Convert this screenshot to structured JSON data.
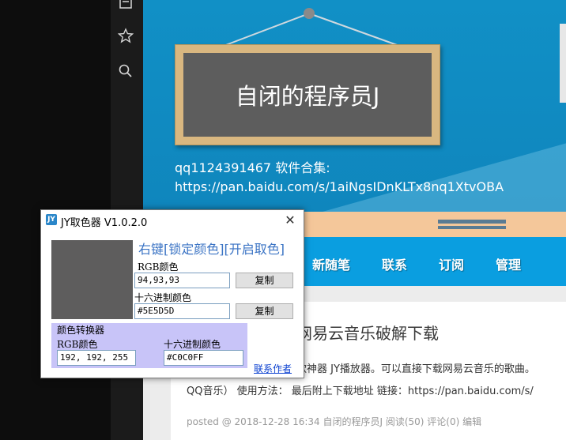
{
  "header": {
    "board_title": "自闭的程序员J",
    "line1": "qq1124391467 软件合集:",
    "line2": "https://pan.baidu.com/s/1aiNgsIDnKLTx8nq1XtvOBA"
  },
  "nav": {
    "items": [
      "新随笔",
      "联系",
      "订阅",
      "管理"
    ]
  },
  "post": {
    "title": "网易云音乐破解下载",
    "desc": "款神器 JY播放器。可以直接下载网易云音乐的歌曲。",
    "desc2": "QQ音乐） 使用方法： 最后附上下载地址 链接：https://pan.baidu.com/s/",
    "meta": "posted @ 2018-12-28 16:34 自闭的程序员J 阅读(50) 评论(0) 编辑"
  },
  "dialog": {
    "icon_text": "JY",
    "title": "JY取色器 V1.0.2.0",
    "close": "✕",
    "hint": "右键[锁定颜色][开启取色]",
    "rgb_label": "RGB颜色",
    "rgb_value": "94,93,93",
    "copy_label": "复制",
    "hex_label": "十六进制颜色",
    "hex_value": "#5E5D5D",
    "preview_color": "#5E5D5D",
    "converter": {
      "title": "颜色转换器",
      "rgb_label": "RGB颜色",
      "rgb_value": "192, 192, 255",
      "hex_label": "十六进制颜色",
      "hex_value": "#C0C0FF"
    },
    "contact": "联系作者"
  },
  "sidebar": {
    "icons": [
      "list-icon",
      "star-icon",
      "search-icon"
    ]
  },
  "colors": {
    "header_blue": "#1190c6",
    "nav_blue": "#0a9ee0",
    "board_wood": "#d9b780",
    "board_slate": "#5d5d5d",
    "converter_bg": "#c8c4f8",
    "link": "#0b40d0"
  }
}
